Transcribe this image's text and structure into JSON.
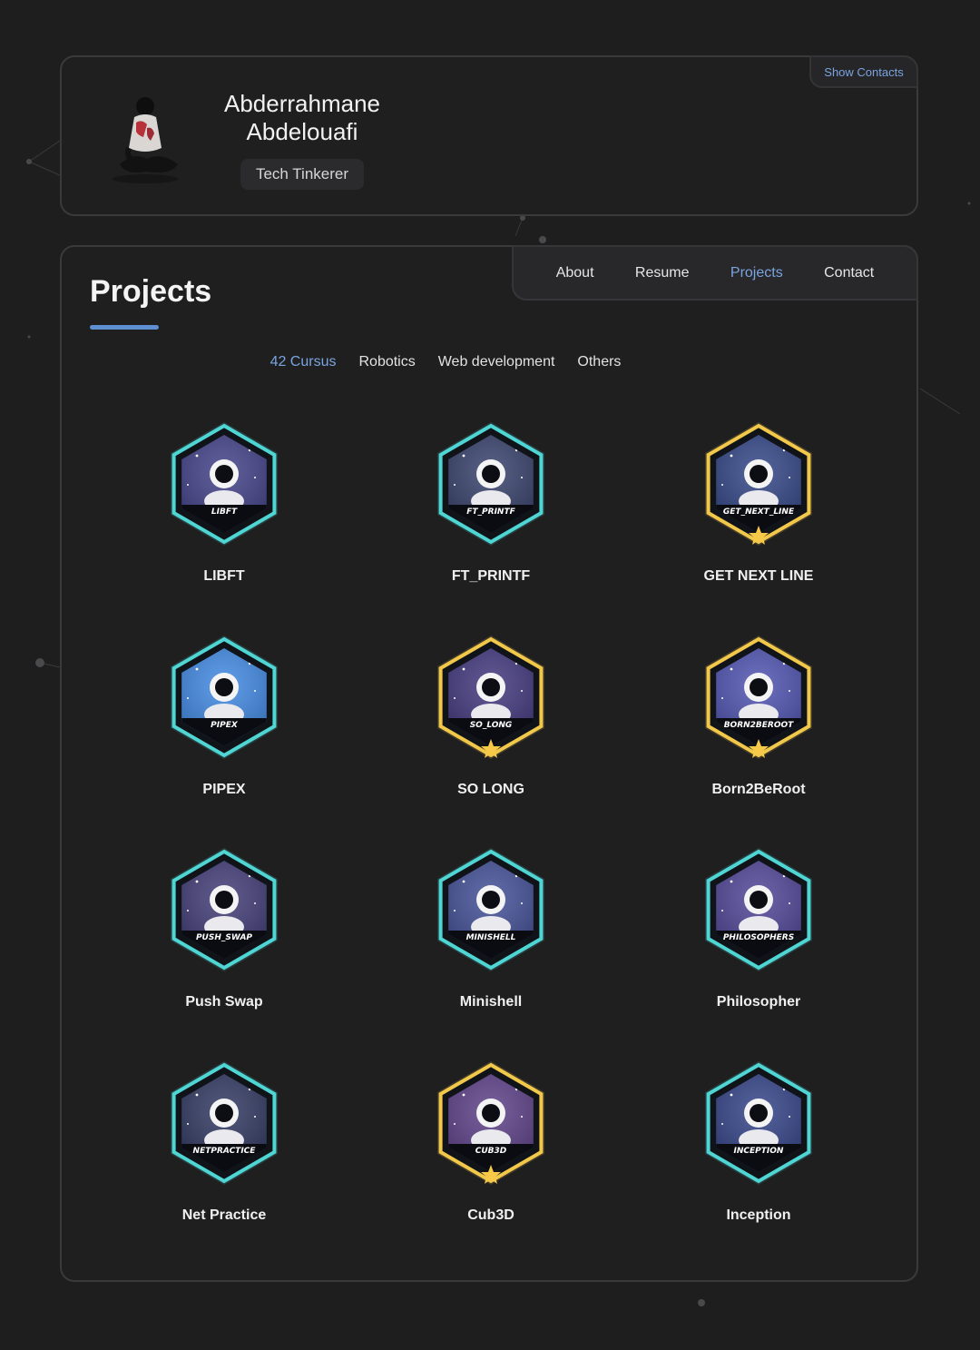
{
  "profile": {
    "name_line1": "Abderrahmane",
    "name_line2": "Abdelouafi",
    "title": "Tech Tinkerer",
    "show_contacts_label": "Show Contacts"
  },
  "nav": {
    "items": [
      {
        "label": "About",
        "active": false
      },
      {
        "label": "Resume",
        "active": false
      },
      {
        "label": "Projects",
        "active": true
      },
      {
        "label": "Contact",
        "active": false
      }
    ]
  },
  "page": {
    "title": "Projects"
  },
  "filters": {
    "items": [
      {
        "label": "42 Cursus",
        "active": true
      },
      {
        "label": "Robotics",
        "active": false
      },
      {
        "label": "Web development",
        "active": false
      },
      {
        "label": "Others",
        "active": false
      }
    ]
  },
  "projects": [
    {
      "name": "LIBFT",
      "badge_label": "LIBFT",
      "frame": "teal",
      "star": false,
      "scene": "#2b2a7a"
    },
    {
      "name": "FT_PRINTF",
      "badge_label": "FT_PRINTF",
      "frame": "teal",
      "star": false,
      "scene": "#1f2a5a"
    },
    {
      "name": "GET NEXT LINE",
      "badge_label": "GET_NEXT_LINE",
      "frame": "gold",
      "star": true,
      "scene": "#1a2f78"
    },
    {
      "name": "PIPEX",
      "badge_label": "PIPEX",
      "frame": "teal",
      "star": false,
      "scene": "#2a7be0"
    },
    {
      "name": "SO LONG",
      "badge_label": "SO_LONG",
      "frame": "gold",
      "star": true,
      "scene": "#2b1f6e"
    },
    {
      "name": "Born2BeRoot",
      "badge_label": "BORN2BEROOT",
      "frame": "gold",
      "star": true,
      "scene": "#3a3fa8"
    },
    {
      "name": "Push Swap",
      "badge_label": "PUSH_SWAP",
      "frame": "teal",
      "star": false,
      "scene": "#2a2466"
    },
    {
      "name": "Minishell",
      "badge_label": "MINISHELL",
      "frame": "teal",
      "star": false,
      "scene": "#2c3a8a"
    },
    {
      "name": "Philosopher",
      "badge_label": "PHILOSOPHERS",
      "frame": "teal",
      "star": false,
      "scene": "#3a2f8a"
    },
    {
      "name": "Net Practice",
      "badge_label": "NETPRACTICE",
      "frame": "teal",
      "star": false,
      "scene": "#18204e"
    },
    {
      "name": "Cub3D",
      "badge_label": "CUB3D",
      "frame": "gold",
      "star": true,
      "scene": "#4a2a7a"
    },
    {
      "name": "Inception",
      "badge_label": "INCEPTION",
      "frame": "teal",
      "star": false,
      "scene": "#1b2d7a"
    }
  ],
  "colors": {
    "accent": "#7aa4e0",
    "frame_teal": "#4fd6d4",
    "frame_gold": "#f2c84b",
    "star": "#f7c948"
  }
}
